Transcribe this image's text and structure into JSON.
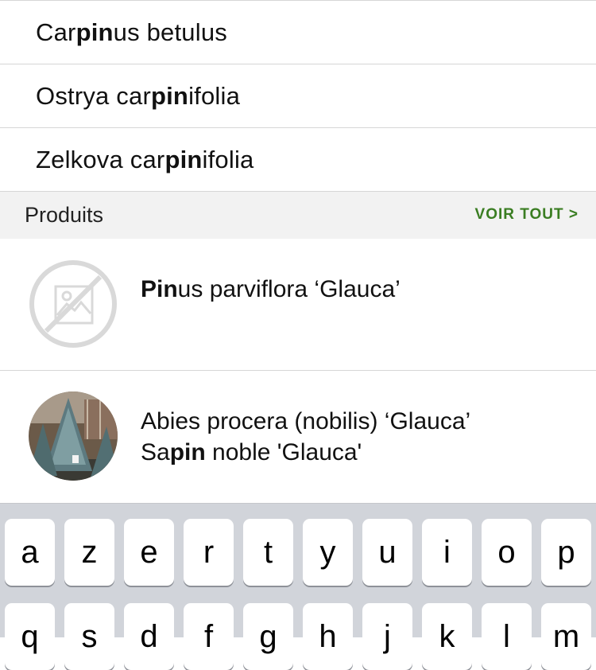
{
  "suggestions": [
    {
      "pre": "Car",
      "match": "pin",
      "post": "us betulus"
    },
    {
      "pre": "Ostrya car",
      "match": "pin",
      "post": "ifolia"
    },
    {
      "pre": "Zelkova car",
      "match": "pin",
      "post": "ifolia"
    }
  ],
  "section": {
    "title": "Produits",
    "see_all": "VOIR TOUT >"
  },
  "products": [
    {
      "line1_pre": "",
      "line1_match": "Pin",
      "line1_post": "us parviflora ‘Glauca’",
      "image": "no-image-icon"
    },
    {
      "line1": "Abies procera (nobilis) ‘Glauca’",
      "line2_pre": "Sa",
      "line2_match": "pin",
      "line2_post": " noble 'Glauca'",
      "image": "fir-tree-photo"
    }
  ],
  "keyboard": {
    "row1": [
      "a",
      "z",
      "e",
      "r",
      "t",
      "y",
      "u",
      "i",
      "o",
      "p"
    ],
    "row2": [
      "q",
      "s",
      "d",
      "f",
      "g",
      "h",
      "j",
      "k",
      "l",
      "m"
    ]
  },
  "colors": {
    "accent": "#3a7d22",
    "header_bg": "#f2f2f2",
    "keyboard_bg": "#d1d4da"
  }
}
